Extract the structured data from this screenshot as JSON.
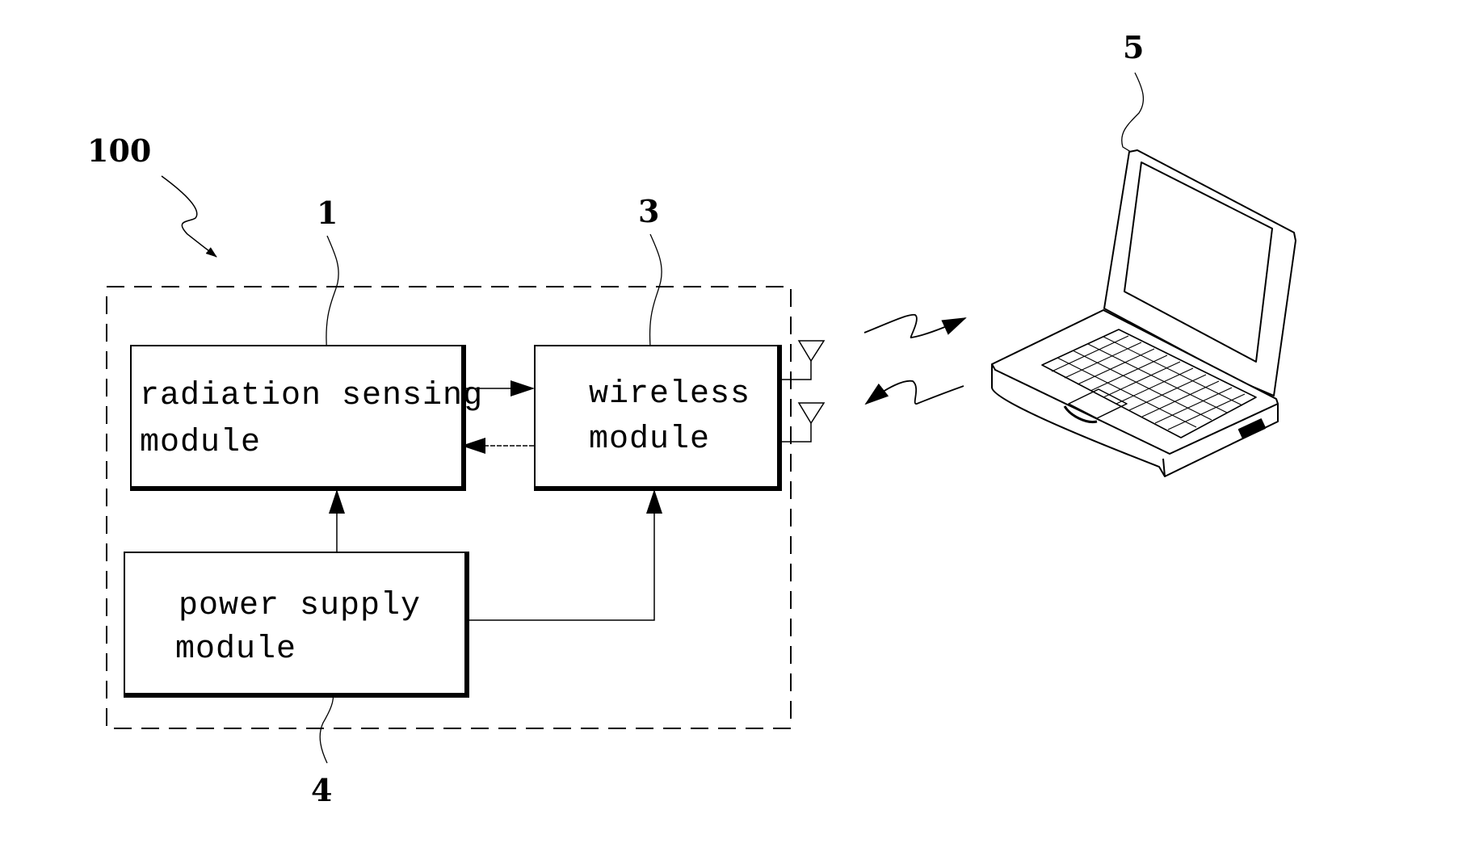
{
  "figure": {
    "system_ref": "100",
    "modules": [
      {
        "ref": "1",
        "line1": "radiation sensing",
        "line2": "module"
      },
      {
        "ref": "3",
        "line1": "wireless",
        "line2": "module"
      },
      {
        "ref": "4",
        "line1": "power supply",
        "line2": "module"
      }
    ],
    "computer": {
      "ref": "5",
      "depicts": "laptop-computer"
    },
    "connections": [
      {
        "from": "radiation sensing module",
        "to": "wireless module"
      },
      {
        "from": "wireless module",
        "to": "radiation sensing module"
      },
      {
        "from": "power supply module",
        "to": "radiation sensing module"
      },
      {
        "from": "power supply module",
        "to": "wireless module"
      },
      {
        "from": "wireless module",
        "to": "laptop computer",
        "type": "wireless"
      },
      {
        "from": "laptop computer",
        "to": "wireless module",
        "type": "wireless"
      }
    ]
  }
}
